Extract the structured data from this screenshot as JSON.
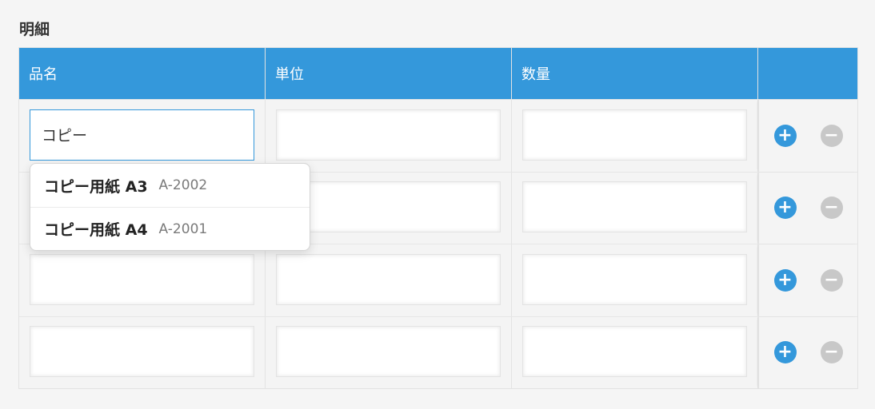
{
  "section": {
    "title": "明細"
  },
  "table": {
    "headers": [
      "品名",
      "単位",
      "数量",
      ""
    ],
    "rows": [
      {
        "name": "コピー",
        "unit": "",
        "qty": ""
      },
      {
        "name": "",
        "unit": "",
        "qty": ""
      },
      {
        "name": "",
        "unit": "",
        "qty": ""
      },
      {
        "name": "",
        "unit": "",
        "qty": ""
      }
    ]
  },
  "buttons": {
    "add": "+",
    "remove": "−"
  },
  "autocomplete": {
    "items": [
      {
        "name": "コピー用紙 A3",
        "code": "A-2002"
      },
      {
        "name": "コピー用紙 A4",
        "code": "A-2001"
      }
    ]
  },
  "icons": {
    "add": "plus-icon",
    "remove": "minus-icon"
  },
  "colors": {
    "header": "#3498db",
    "add_button": "#3498db",
    "remove_button": "#c8c8c8"
  }
}
